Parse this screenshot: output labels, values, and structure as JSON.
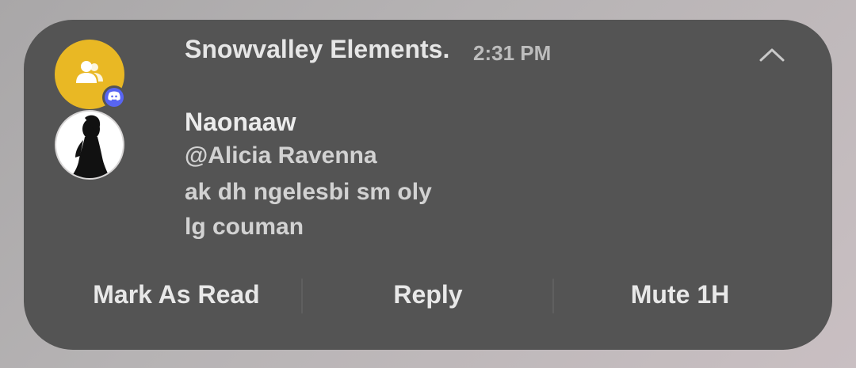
{
  "notification": {
    "app_icon": "discord-icon",
    "group_icon": "group-icon",
    "group_name": "Snowvalley Elements.",
    "time": "2:31 PM",
    "collapse_icon": "chevron-up-icon",
    "sender": "Naonaaw",
    "message_lines": [
      "@Alicia Ravenna",
      "ak dh ngelesbi sm oly",
      "lg couman"
    ]
  },
  "actions": {
    "mark_read": "Mark As Read",
    "reply": "Reply",
    "mute": "Mute 1H"
  },
  "colors": {
    "card_bg": "#545454",
    "group_avatar_bg": "#e9b824",
    "discord_blurple": "#5865f2"
  }
}
